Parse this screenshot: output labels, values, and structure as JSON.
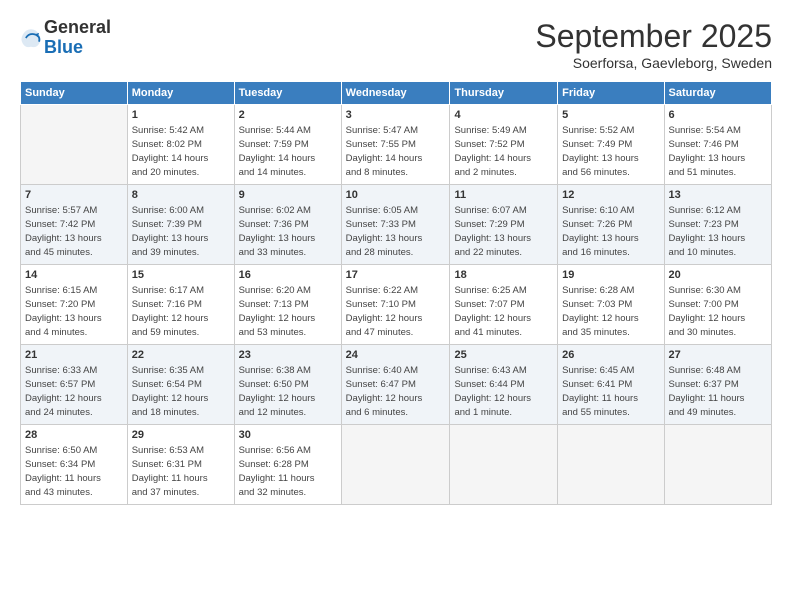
{
  "logo": {
    "general": "General",
    "blue": "Blue"
  },
  "title": "September 2025",
  "location": "Soerforsa, Gaevleborg, Sweden",
  "headers": [
    "Sunday",
    "Monday",
    "Tuesday",
    "Wednesday",
    "Thursday",
    "Friday",
    "Saturday"
  ],
  "weeks": [
    {
      "shade": false,
      "days": [
        {
          "num": "",
          "info": ""
        },
        {
          "num": "1",
          "info": "Sunrise: 5:42 AM\nSunset: 8:02 PM\nDaylight: 14 hours\nand 20 minutes."
        },
        {
          "num": "2",
          "info": "Sunrise: 5:44 AM\nSunset: 7:59 PM\nDaylight: 14 hours\nand 14 minutes."
        },
        {
          "num": "3",
          "info": "Sunrise: 5:47 AM\nSunset: 7:55 PM\nDaylight: 14 hours\nand 8 minutes."
        },
        {
          "num": "4",
          "info": "Sunrise: 5:49 AM\nSunset: 7:52 PM\nDaylight: 14 hours\nand 2 minutes."
        },
        {
          "num": "5",
          "info": "Sunrise: 5:52 AM\nSunset: 7:49 PM\nDaylight: 13 hours\nand 56 minutes."
        },
        {
          "num": "6",
          "info": "Sunrise: 5:54 AM\nSunset: 7:46 PM\nDaylight: 13 hours\nand 51 minutes."
        }
      ]
    },
    {
      "shade": true,
      "days": [
        {
          "num": "7",
          "info": "Sunrise: 5:57 AM\nSunset: 7:42 PM\nDaylight: 13 hours\nand 45 minutes."
        },
        {
          "num": "8",
          "info": "Sunrise: 6:00 AM\nSunset: 7:39 PM\nDaylight: 13 hours\nand 39 minutes."
        },
        {
          "num": "9",
          "info": "Sunrise: 6:02 AM\nSunset: 7:36 PM\nDaylight: 13 hours\nand 33 minutes."
        },
        {
          "num": "10",
          "info": "Sunrise: 6:05 AM\nSunset: 7:33 PM\nDaylight: 13 hours\nand 28 minutes."
        },
        {
          "num": "11",
          "info": "Sunrise: 6:07 AM\nSunset: 7:29 PM\nDaylight: 13 hours\nand 22 minutes."
        },
        {
          "num": "12",
          "info": "Sunrise: 6:10 AM\nSunset: 7:26 PM\nDaylight: 13 hours\nand 16 minutes."
        },
        {
          "num": "13",
          "info": "Sunrise: 6:12 AM\nSunset: 7:23 PM\nDaylight: 13 hours\nand 10 minutes."
        }
      ]
    },
    {
      "shade": false,
      "days": [
        {
          "num": "14",
          "info": "Sunrise: 6:15 AM\nSunset: 7:20 PM\nDaylight: 13 hours\nand 4 minutes."
        },
        {
          "num": "15",
          "info": "Sunrise: 6:17 AM\nSunset: 7:16 PM\nDaylight: 12 hours\nand 59 minutes."
        },
        {
          "num": "16",
          "info": "Sunrise: 6:20 AM\nSunset: 7:13 PM\nDaylight: 12 hours\nand 53 minutes."
        },
        {
          "num": "17",
          "info": "Sunrise: 6:22 AM\nSunset: 7:10 PM\nDaylight: 12 hours\nand 47 minutes."
        },
        {
          "num": "18",
          "info": "Sunrise: 6:25 AM\nSunset: 7:07 PM\nDaylight: 12 hours\nand 41 minutes."
        },
        {
          "num": "19",
          "info": "Sunrise: 6:28 AM\nSunset: 7:03 PM\nDaylight: 12 hours\nand 35 minutes."
        },
        {
          "num": "20",
          "info": "Sunrise: 6:30 AM\nSunset: 7:00 PM\nDaylight: 12 hours\nand 30 minutes."
        }
      ]
    },
    {
      "shade": true,
      "days": [
        {
          "num": "21",
          "info": "Sunrise: 6:33 AM\nSunset: 6:57 PM\nDaylight: 12 hours\nand 24 minutes."
        },
        {
          "num": "22",
          "info": "Sunrise: 6:35 AM\nSunset: 6:54 PM\nDaylight: 12 hours\nand 18 minutes."
        },
        {
          "num": "23",
          "info": "Sunrise: 6:38 AM\nSunset: 6:50 PM\nDaylight: 12 hours\nand 12 minutes."
        },
        {
          "num": "24",
          "info": "Sunrise: 6:40 AM\nSunset: 6:47 PM\nDaylight: 12 hours\nand 6 minutes."
        },
        {
          "num": "25",
          "info": "Sunrise: 6:43 AM\nSunset: 6:44 PM\nDaylight: 12 hours\nand 1 minute."
        },
        {
          "num": "26",
          "info": "Sunrise: 6:45 AM\nSunset: 6:41 PM\nDaylight: 11 hours\nand 55 minutes."
        },
        {
          "num": "27",
          "info": "Sunrise: 6:48 AM\nSunset: 6:37 PM\nDaylight: 11 hours\nand 49 minutes."
        }
      ]
    },
    {
      "shade": false,
      "days": [
        {
          "num": "28",
          "info": "Sunrise: 6:50 AM\nSunset: 6:34 PM\nDaylight: 11 hours\nand 43 minutes."
        },
        {
          "num": "29",
          "info": "Sunrise: 6:53 AM\nSunset: 6:31 PM\nDaylight: 11 hours\nand 37 minutes."
        },
        {
          "num": "30",
          "info": "Sunrise: 6:56 AM\nSunset: 6:28 PM\nDaylight: 11 hours\nand 32 minutes."
        },
        {
          "num": "",
          "info": ""
        },
        {
          "num": "",
          "info": ""
        },
        {
          "num": "",
          "info": ""
        },
        {
          "num": "",
          "info": ""
        }
      ]
    }
  ]
}
